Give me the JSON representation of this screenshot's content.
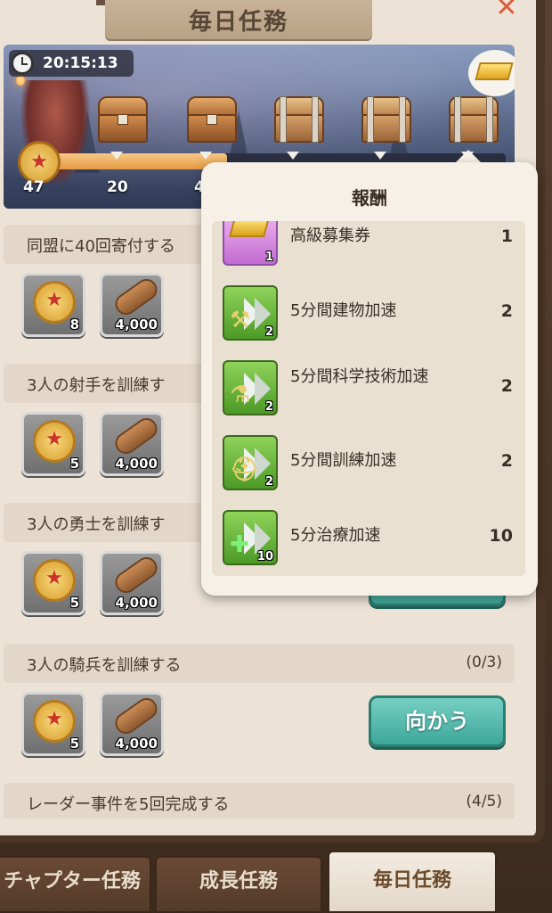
{
  "header": {
    "title": "毎日任務",
    "close_icon": "close-icon",
    "timer": "20:15:13"
  },
  "milestones": {
    "current_score": "47",
    "labels": [
      "20",
      "4"
    ],
    "progress_fraction": 0.47
  },
  "tasks": [
    {
      "name": "同盟に40回寄付する",
      "progress": "",
      "rewards": [
        {
          "type": "medal-icon",
          "qty": "8"
        },
        {
          "type": "wood-log-icon",
          "qty": "4,000"
        }
      ]
    },
    {
      "name": "3人の射手を訓練す",
      "progress": "",
      "rewards": [
        {
          "type": "medal-icon",
          "qty": "5"
        },
        {
          "type": "wood-log-icon",
          "qty": "4,000"
        }
      ]
    },
    {
      "name": "3人の勇士を訓練す",
      "progress": "",
      "rewards": [
        {
          "type": "medal-icon",
          "qty": "5"
        },
        {
          "type": "wood-log-icon",
          "qty": "4,000"
        }
      ]
    },
    {
      "name": "3人の騎兵を訓練する",
      "progress": "(0/3)",
      "rewards": [
        {
          "type": "medal-icon",
          "qty": "5"
        },
        {
          "type": "wood-log-icon",
          "qty": "4,000"
        }
      ],
      "button": "向かう"
    },
    {
      "name": "レーダー事件を5回完成する",
      "progress": "(4/5)"
    }
  ],
  "popover": {
    "title": "報酬",
    "items": [
      {
        "name": "高級募集券",
        "count": "1",
        "icon_qty": "1"
      },
      {
        "name": "5分間建物加速",
        "count": "2",
        "icon_qty": "2"
      },
      {
        "name": "5分間科学技術加速",
        "count": "2",
        "icon_qty": "2"
      },
      {
        "name": "5分間訓練加速",
        "count": "2",
        "icon_qty": "2"
      },
      {
        "name": "5分治療加速",
        "count": "10",
        "icon_qty": "10"
      }
    ]
  },
  "tabs": [
    {
      "label": "チャプター任務"
    },
    {
      "label": "成長任務"
    },
    {
      "label": "毎日任務",
      "active": true
    }
  ]
}
